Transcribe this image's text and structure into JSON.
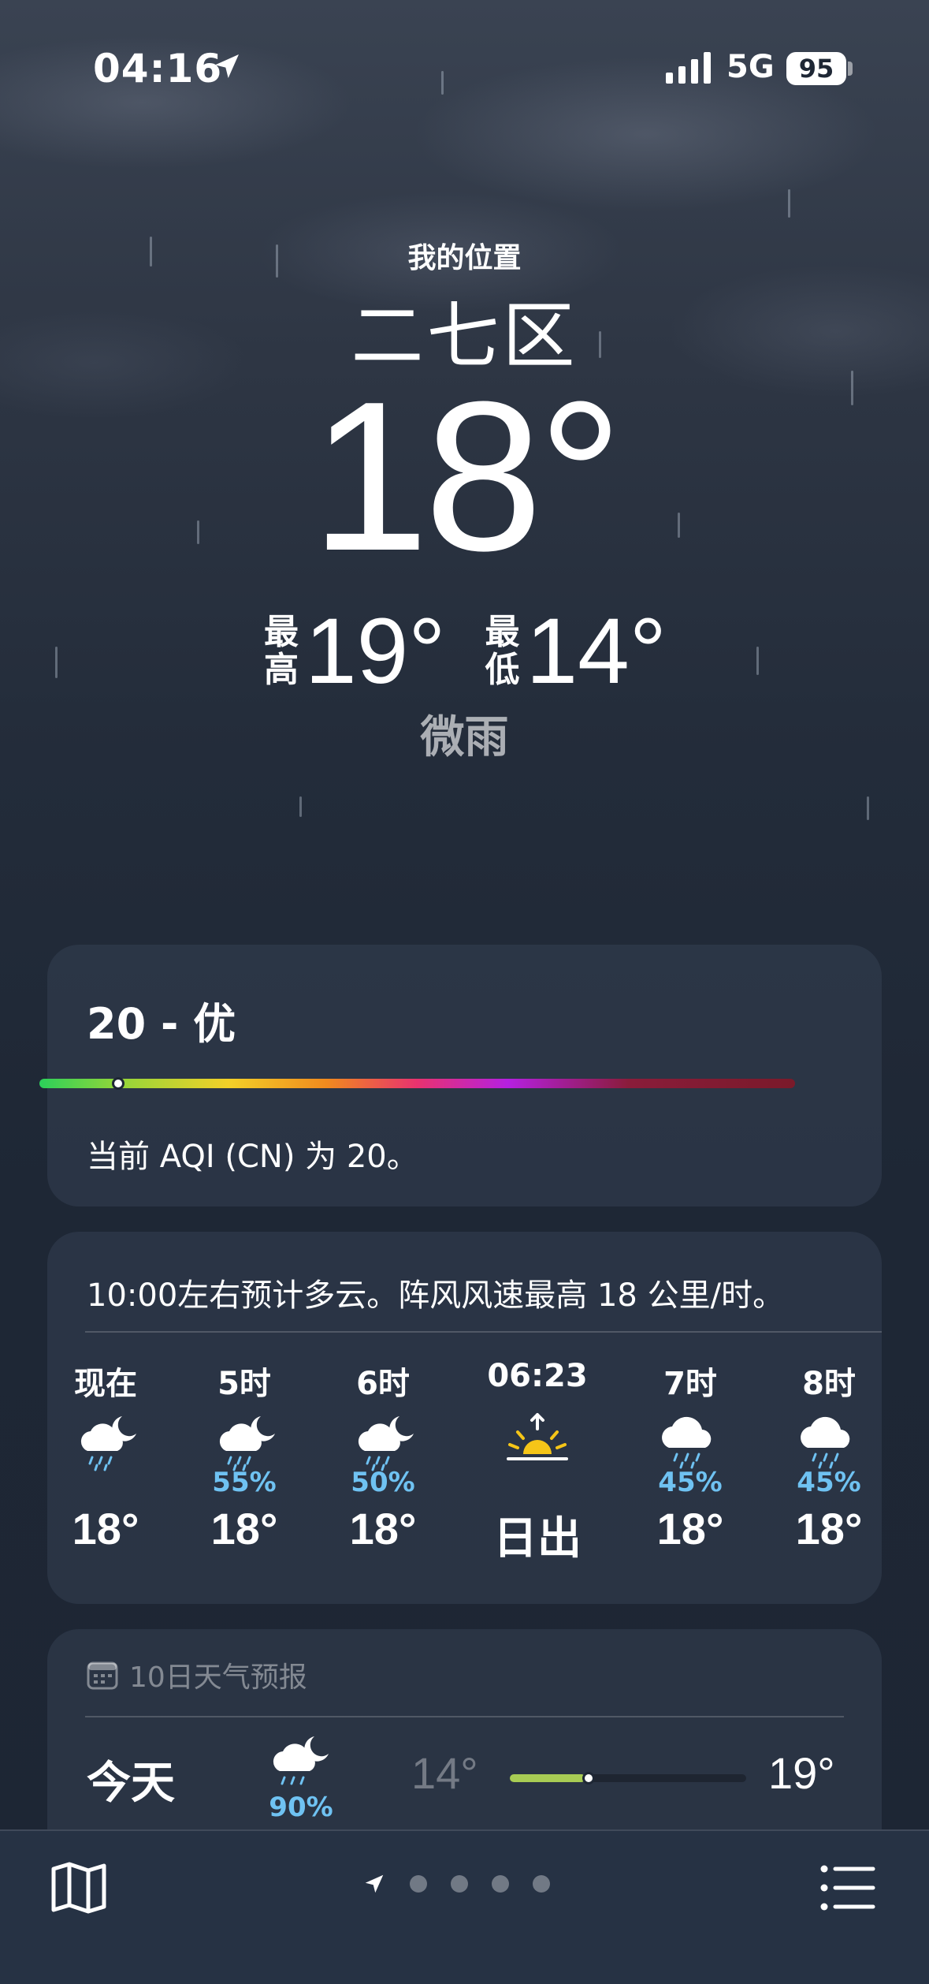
{
  "status_bar": {
    "time": "04:16",
    "network": "5G",
    "battery": "95"
  },
  "hero": {
    "my_location_label": "我的位置",
    "city": "二七区",
    "temperature": "18°",
    "high_label": "最高",
    "high": "19°",
    "low_label": "最低",
    "low": "14°",
    "condition": "微雨"
  },
  "aqi": {
    "title": "20 - 优",
    "description": "当前 AQI (CN) 为 20。",
    "value": 20
  },
  "hourly": {
    "summary": "10:00左右预计多云。阵风风速最高 18 公里/时。",
    "items": [
      {
        "time": "现在",
        "icon": "cloud-moon-rain-icon",
        "precip": "",
        "temp": "18°"
      },
      {
        "time": "5时",
        "icon": "cloud-moon-rain-icon",
        "precip": "55%",
        "temp": "18°"
      },
      {
        "time": "6时",
        "icon": "cloud-moon-rain-icon",
        "precip": "50%",
        "temp": "18°"
      },
      {
        "time": "06:23",
        "icon": "sunrise-icon",
        "precip": "",
        "temp": "日出"
      },
      {
        "time": "7时",
        "icon": "cloud-rain-icon",
        "precip": "45%",
        "temp": "18°"
      },
      {
        "time": "8时",
        "icon": "cloud-rain-icon",
        "precip": "45%",
        "temp": "18°"
      }
    ]
  },
  "forecast": {
    "header": "10日天气预报",
    "rows": [
      {
        "day": "今天",
        "icon": "cloud-moon-rain-icon",
        "precip": "90%",
        "low": "14°",
        "high": "19°"
      }
    ]
  },
  "colors": {
    "precip": "#6fc2f2",
    "sun": "#f5c518",
    "range_fill": "#a8cc54"
  }
}
